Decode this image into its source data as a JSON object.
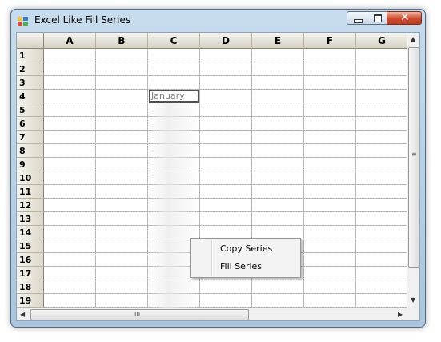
{
  "window": {
    "title": "Excel Like Fill Series",
    "controls": {
      "minimize": "minimize",
      "maximize": "maximize",
      "close": "✕"
    }
  },
  "grid": {
    "columns": [
      "A",
      "B",
      "C",
      "D",
      "E",
      "F",
      "G"
    ],
    "rows": [
      "1",
      "2",
      "3",
      "4",
      "5",
      "6",
      "7",
      "8",
      "9",
      "10",
      "11",
      "12",
      "13",
      "14",
      "15",
      "16",
      "17",
      "18",
      "19"
    ],
    "active_cell": {
      "ref": "C4",
      "value": "January"
    }
  },
  "context_menu": {
    "items": [
      "Copy Series",
      "Fill Series"
    ]
  },
  "scrollbars": {
    "h_grip": "III",
    "v_grip": "≡",
    "up": "▲",
    "down": "▼",
    "left": "◀",
    "right": "▶"
  },
  "colors": {
    "header_bg": "#d6d2c2",
    "grid_line": "#a8a8a8",
    "window_frame": "#a9c6dd",
    "close_button": "#c23d1e"
  }
}
